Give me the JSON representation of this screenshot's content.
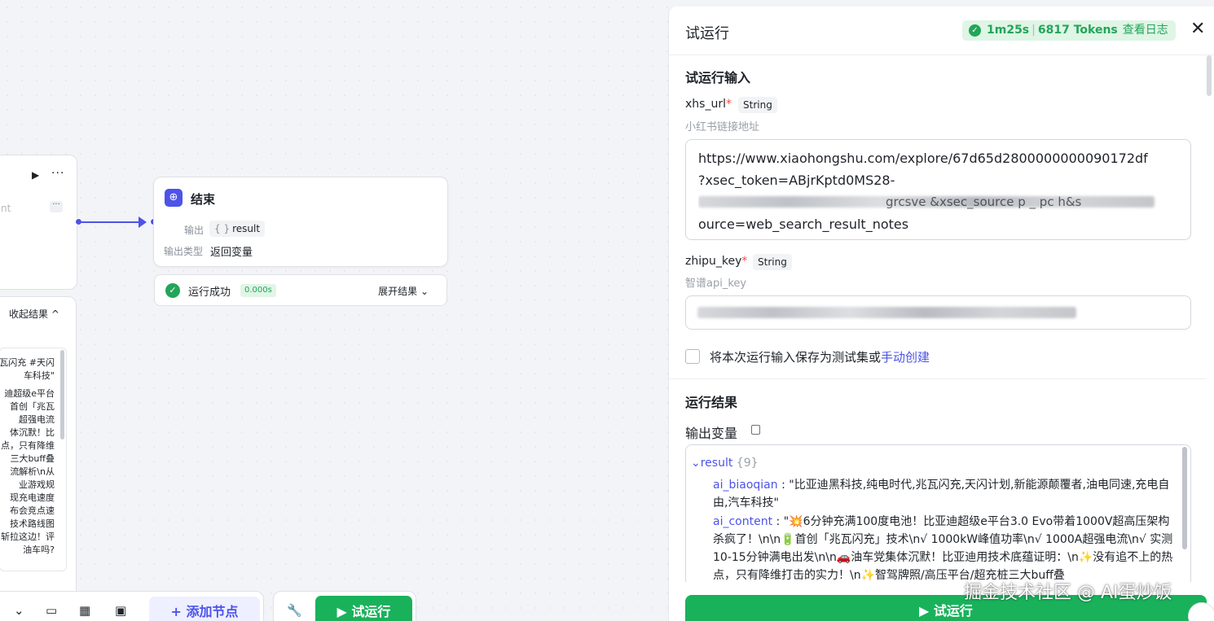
{
  "canvas": {
    "left_node": {
      "label_partial": "nt"
    },
    "left_result": {
      "collapse_label": "收起结果 ^",
      "text_lines": [
        "瓦闪充 #天闪",
        "车科技\"",
        "迪超级e平台",
        "首创「兆瓦",
        "超强电流",
        "体沉默！比",
        "点，只有降维",
        "三大buff叠",
        "流解析\\n从",
        "业游戏规",
        "现充电速度",
        "布会竞点速",
        "技术路线图",
        "斩拉这边！评",
        "油车吗?"
      ]
    },
    "end_node": {
      "title": "结束",
      "output_label": "输出",
      "output_value": "result",
      "output_type_label": "输出类型",
      "output_type_value": "返回变量"
    },
    "run_status": {
      "text": "运行成功",
      "time": "0.000s",
      "expand": "展开结果 ⌄"
    },
    "toolbar": {
      "add_node": "+  添加节点",
      "trial_run": "▶  试运行"
    }
  },
  "panel": {
    "title": "试运行",
    "status": {
      "duration": "1m25s",
      "tokens": "6817 Tokens",
      "log": "查看日志"
    },
    "input_section": "试运行输入",
    "inputs": [
      {
        "name": "xhs_url",
        "type": "String",
        "hint": "小红书链接地址",
        "line1": "https://www.xiaohongshu.com/explore/67d65d2800000000090172df",
        "line2": "?xsec_token=ABjrKptd0MS28-",
        "line3_visible": "grcsve  &xsec_source  p  _  pc  h&s",
        "line4": "ource=web_search_result_notes"
      },
      {
        "name": "zhipu_key",
        "type": "String",
        "hint": "智谱api_key"
      }
    ],
    "save_label": "将本次运行输入保存为测试集或",
    "save_link": "手动创建",
    "result_section": "运行结果",
    "output_var": "输出变量",
    "json": {
      "root_key": "result",
      "root_count": "{9}",
      "k1": "ai_biaoqian",
      "v1": "\"比亚迪黑科技,纯电时代,兆瓦闪充,天闪计划,新能源颠覆者,油电同速,充电自由,汽车科技\"",
      "k2": "ai_content",
      "v2": "\"💥6分钟充满100度电池！比亚迪超级e平台3.0 Evo带着1000V超高压架构杀疯了！\\n\\n🔋首创「兆瓦闪充」技术\\n√ 1000kW峰值功率\\n√ 1000A超强电流\\n√ 实测10-15分钟满电出发\\n\\n🚗油车党集体沉默！比亚迪用技术底蕴证明：\\n✨没有追不上的热点，只有降维打击的实力！\\n✨智驾牌照/高压平台/超充桩三大buff叠"
    },
    "run_button": "▶  试运行",
    "watermark": "掘金技术社区 @ AI蛋炒饭"
  }
}
